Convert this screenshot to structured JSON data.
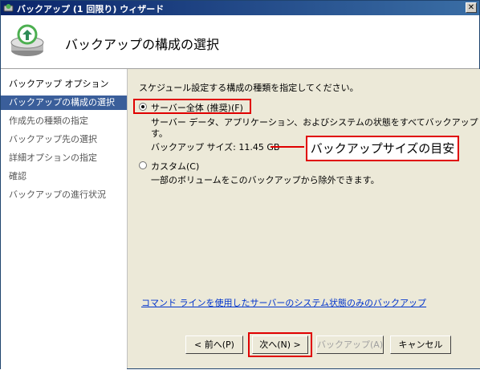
{
  "window": {
    "title": "バックアップ (1 回限り) ウィザード",
    "close_label": "✕"
  },
  "header": {
    "title": "バックアップの構成の選択"
  },
  "sidebar": {
    "items": [
      {
        "label": "バックアップ オプション"
      },
      {
        "label": "バックアップの構成の選択"
      },
      {
        "label": "作成先の種類の指定"
      },
      {
        "label": "バックアップ先の選択"
      },
      {
        "label": "詳細オプションの指定"
      },
      {
        "label": "確認"
      },
      {
        "label": "バックアップの進行状況"
      }
    ]
  },
  "main": {
    "instruction": "スケジュール設定する構成の種類を指定してください。",
    "option_full": {
      "label": "サーバー全体 (推奨)(F)",
      "description": "サーバー データ、アプリケーション、およびシステムの状態をすべてバックアップしま",
      "description_end": "す。",
      "size_text": "バックアップ サイズ: 11.45 GB",
      "selected": true
    },
    "option_custom": {
      "label": "カスタム(C)",
      "description": "一部のボリュームをこのバックアップから除外できます。",
      "selected": false
    },
    "annotation": "バックアップサイズの目安",
    "link": "コマンド ラインを使用したサーバーのシステム状態のみのバックアップ"
  },
  "footer": {
    "back_label": "< 前へ(P)",
    "next_label": "次へ(N) >",
    "backup_label": "バックアップ(A)",
    "cancel_label": "キャンセル"
  },
  "colors": {
    "highlight": "#e00000",
    "selection": "#3a5e9a",
    "link": "#0033cc"
  }
}
